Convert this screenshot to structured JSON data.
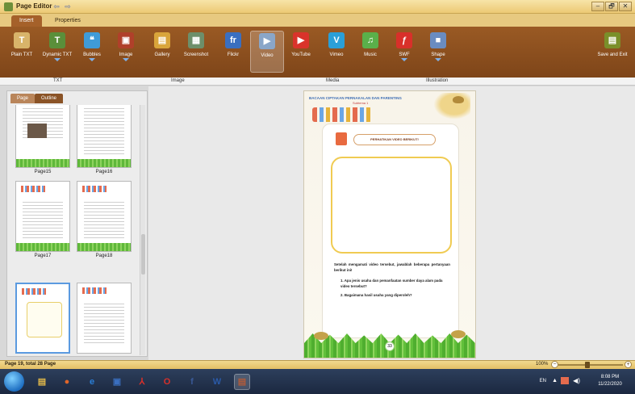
{
  "titlebar": {
    "title": "Page Editor",
    "controls": [
      "–",
      "🗗",
      "✕"
    ]
  },
  "ribbon_tabs": [
    {
      "label": "Insert",
      "active": true
    },
    {
      "label": "Properties",
      "active": false
    }
  ],
  "ribbon_buttons": [
    {
      "label": "Plain TXT",
      "icon": "plain-text-icon",
      "glyph": "T",
      "color": "#d8b46a",
      "has_menu": false
    },
    {
      "label": "Dynamic TXT",
      "icon": "dynamic-text-icon",
      "glyph": "T",
      "color": "#5a8f3a",
      "has_menu": true
    },
    {
      "label": "Bubbles",
      "icon": "bubbles-icon",
      "glyph": "❝",
      "color": "#3f9bd8",
      "has_menu": true
    },
    {
      "label": "Image",
      "icon": "image-icon",
      "glyph": "▣",
      "color": "#b0402a",
      "has_menu": true
    },
    {
      "label": "Gallery",
      "icon": "gallery-icon",
      "glyph": "▤",
      "color": "#d9a53b",
      "has_menu": false
    },
    {
      "label": "Screenshot",
      "icon": "screenshot-icon",
      "glyph": "▦",
      "color": "#6d8f6a",
      "has_menu": false
    },
    {
      "label": "Flickr",
      "icon": "flickr-icon",
      "glyph": "fr",
      "color": "#3a6fc0",
      "has_menu": false
    },
    {
      "label": "Video",
      "icon": "video-icon",
      "glyph": "▶",
      "color": "#8aa6c8",
      "has_menu": false
    },
    {
      "label": "YouTube",
      "icon": "youtube-icon",
      "glyph": "▶",
      "color": "#d9332b",
      "has_menu": false
    },
    {
      "label": "Vimeo",
      "icon": "vimeo-icon",
      "glyph": "V",
      "color": "#2a9fd8",
      "has_menu": false
    },
    {
      "label": "Music",
      "icon": "music-icon",
      "glyph": "♫",
      "color": "#5ab04a",
      "has_menu": false
    },
    {
      "label": "SWF",
      "icon": "swf-icon",
      "glyph": "ƒ",
      "color": "#d8302a",
      "has_menu": true
    },
    {
      "label": "Shape",
      "icon": "shape-icon",
      "glyph": "■",
      "color": "#6a8cc0",
      "has_menu": true
    },
    {
      "label": "Save and Exit",
      "icon": "save-exit-icon",
      "glyph": "▤",
      "color": "#7a8f2a",
      "has_menu": false
    }
  ],
  "groups": [
    {
      "label": "TXT"
    },
    {
      "label": "Image"
    },
    {
      "label": "Media"
    },
    {
      "label": "Illustration"
    }
  ],
  "left_panel": {
    "tabs": [
      {
        "label": "Page",
        "active": false
      },
      {
        "label": "Outline",
        "active": true
      }
    ],
    "thumbnails": [
      {
        "label": "Page15"
      },
      {
        "label": "Page16"
      },
      {
        "label": "Page17"
      },
      {
        "label": "Page18"
      },
      {
        "label": "",
        "selected": true
      },
      {
        "label": ""
      }
    ]
  },
  "page": {
    "header": "BACAAN CIPTAKAN PERNAKALAN DAN PARENTING",
    "subheader": "Subtema 1",
    "pill_text": "PERHATIKAN VIDEO BERIKUT!",
    "paragraph": "Setelah mengamati video tersebut, jawablah beberapa pertanyaan berikut ini!",
    "questions": [
      "1. Apa jenis usaha dan pemanfaatan sumber daya alam pada video tersebut?",
      "2. Bagaimana hasil usaha yang diperoleh?"
    ],
    "page_number": "33"
  },
  "statusbar": {
    "text": "Page 19, total 28 Page",
    "zoom": "100%",
    "zoom_level": 0.45
  },
  "taskbar": {
    "apps": [
      {
        "icon": "file-explorer-icon",
        "glyph": "▤",
        "color": "#e0b84a"
      },
      {
        "icon": "firefox-icon",
        "glyph": "●",
        "color": "#e0662a"
      },
      {
        "icon": "internet-explorer-icon",
        "glyph": "e",
        "color": "#2a7fd8"
      },
      {
        "icon": "app-window-icon",
        "glyph": "▣",
        "color": "#3a6fc0"
      },
      {
        "icon": "acrobat-icon",
        "glyph": "⅄",
        "color": "#d8302a"
      },
      {
        "icon": "opera-icon",
        "glyph": "O",
        "color": "#d8302a"
      },
      {
        "icon": "facebook-icon",
        "glyph": "f",
        "color": "#3a5a98"
      },
      {
        "icon": "word-icon",
        "glyph": "W",
        "color": "#2a5aa8"
      },
      {
        "icon": "page-editor-icon",
        "glyph": "▤",
        "color": "#b05a3a",
        "active": true
      }
    ],
    "language": "EN",
    "time": "8:08 PM",
    "date": "11/22/2020"
  }
}
